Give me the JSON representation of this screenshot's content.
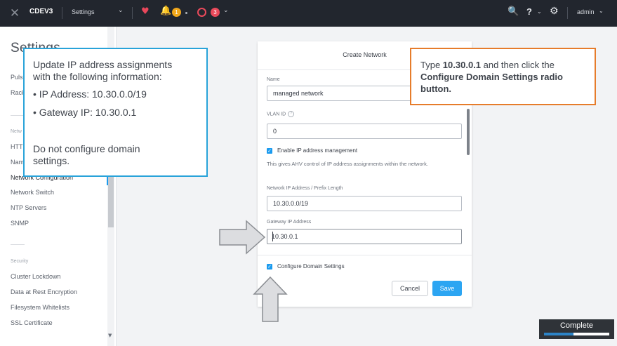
{
  "topbar": {
    "cluster": "CDEV3",
    "menu": "Settings",
    "alert_count": "1",
    "critical_count": "3",
    "help": "?",
    "user": "admin"
  },
  "sidebar": {
    "title": "Settings",
    "items_top": [
      "Puls",
      "Rack"
    ],
    "network_section": "Netw",
    "network_items": [
      "HTT",
      "Nam",
      "Network Configuration",
      "Network Switch",
      "NTP Servers",
      "SNMP"
    ],
    "security_section": "Security",
    "security_items": [
      "Cluster Lockdown",
      "Data at Rest Encryption",
      "Filesystem Whitelists",
      "SSL Certificate"
    ]
  },
  "modal": {
    "title": "Create Network",
    "name_label": "Name",
    "name_value": "managed network",
    "vlan_label": "VLAN ID",
    "vlan_value": "0",
    "ipam_label": "Enable IP address management",
    "ipam_desc": "This gives AHV control of IP address assignments within the network.",
    "prefix_label": "Network IP Address / Prefix Length",
    "prefix_value": "10.30.0.0/19",
    "gateway_label": "Gateway IP Address",
    "gateway_value": "10.30.0.1",
    "domain_label": "Configure Domain Settings",
    "cancel": "Cancel",
    "save": "Save"
  },
  "callout_blue": {
    "line1": "Update IP address assignments",
    "line2": "with the following information:",
    "bullet1": "• IP Address: 10.30.0.0/19",
    "bullet2": "• Gateway IP: 10.30.0.1",
    "note1": "Do not configure domain",
    "note2": "settings."
  },
  "callout_orange": {
    "pre": "Type ",
    "value": "10.30.0.1",
    "mid": " and then click the ",
    "target": "Configure Domain Settings radio button."
  },
  "progress": {
    "label": "Complete",
    "fraction": 0.45
  },
  "colors": {
    "accent": "#1b9bef",
    "callout_blue": "#29a3d9",
    "callout_orange": "#e67c2b",
    "topbar": "#22262e"
  }
}
